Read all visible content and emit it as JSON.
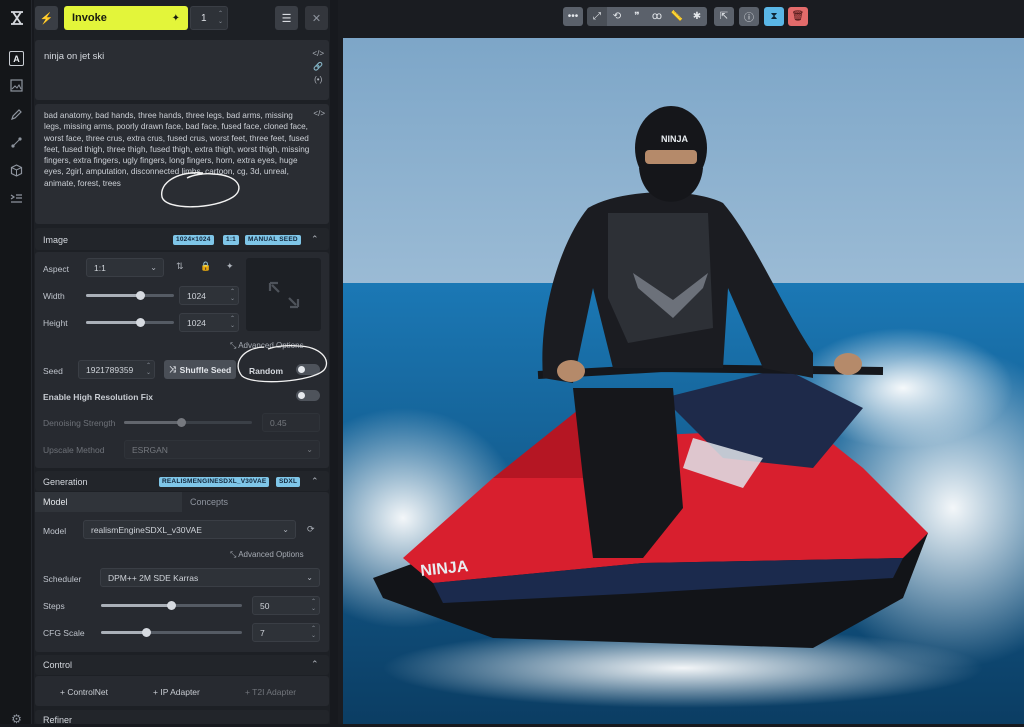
{
  "header": {
    "invoke_label": "Invoke",
    "iterations": "1"
  },
  "prompts": {
    "positive": "ninja on jet ski",
    "negative": "bad anatomy, bad hands, three hands, three legs, bad arms, missing legs, missing arms, poorly drawn face, bad face, fused face, cloned face, worst face, three crus, extra crus, fused crus, worst feet, three feet, fused feet, fused thigh, three thigh, fused thigh, extra thigh, worst thigh, missing fingers, extra fingers, ugly fingers, long fingers, horn, extra eyes, huge eyes, 2girl, amputation, disconnected limbs, cartoon, cg, 3d, unreal, animate, forest, trees"
  },
  "image_section": {
    "title": "Image",
    "badges": [
      "1024×1024",
      "1:1",
      "MANUAL SEED"
    ],
    "aspect_label": "Aspect",
    "aspect_value": "1:1",
    "width_label": "Width",
    "width_value": "1024",
    "width_fraction": 0.62,
    "height_label": "Height",
    "height_value": "1024",
    "height_fraction": 0.62,
    "advanced_label": "Advanced Options",
    "seed_label": "Seed",
    "seed_value": "1921789359",
    "shuffle_label": "Shuffle Seed",
    "random_label": "Random",
    "hires_label": "Enable High Resolution Fix",
    "denoise_label": "Denoising Strength",
    "denoise_value": "0.45",
    "denoise_fraction": 0.45,
    "upscale_label": "Upscale Method",
    "upscale_value": "ESRGAN"
  },
  "generation_section": {
    "title": "Generation",
    "badges": [
      "REALISMENGINESDXL_V30VAE",
      "SDXL"
    ],
    "tab_model": "Model",
    "tab_concepts": "Concepts",
    "model_label": "Model",
    "model_value": "realismEngineSDXL_v30VAE",
    "advanced_label": "Advanced Options",
    "scheduler_label": "Scheduler",
    "scheduler_value": "DPM++ 2M SDE Karras",
    "steps_label": "Steps",
    "steps_value": "50",
    "steps_fraction": 0.5,
    "cfg_label": "CFG Scale",
    "cfg_value": "7",
    "cfg_fraction": 0.32
  },
  "control_section": {
    "title": "Control",
    "controlnet": "ControlNet",
    "ip_adapter": "IP Adapter",
    "t2i_adapter": "T2I Adapter"
  },
  "refiner_section": {
    "title": "Refiner"
  },
  "photo": {
    "jetski_text": "NINJA",
    "helmet_text": "NINJA"
  },
  "colors": {
    "invoke": "#e3f53a",
    "delete": "#e36b6b",
    "accent": "#7fc6e8"
  }
}
